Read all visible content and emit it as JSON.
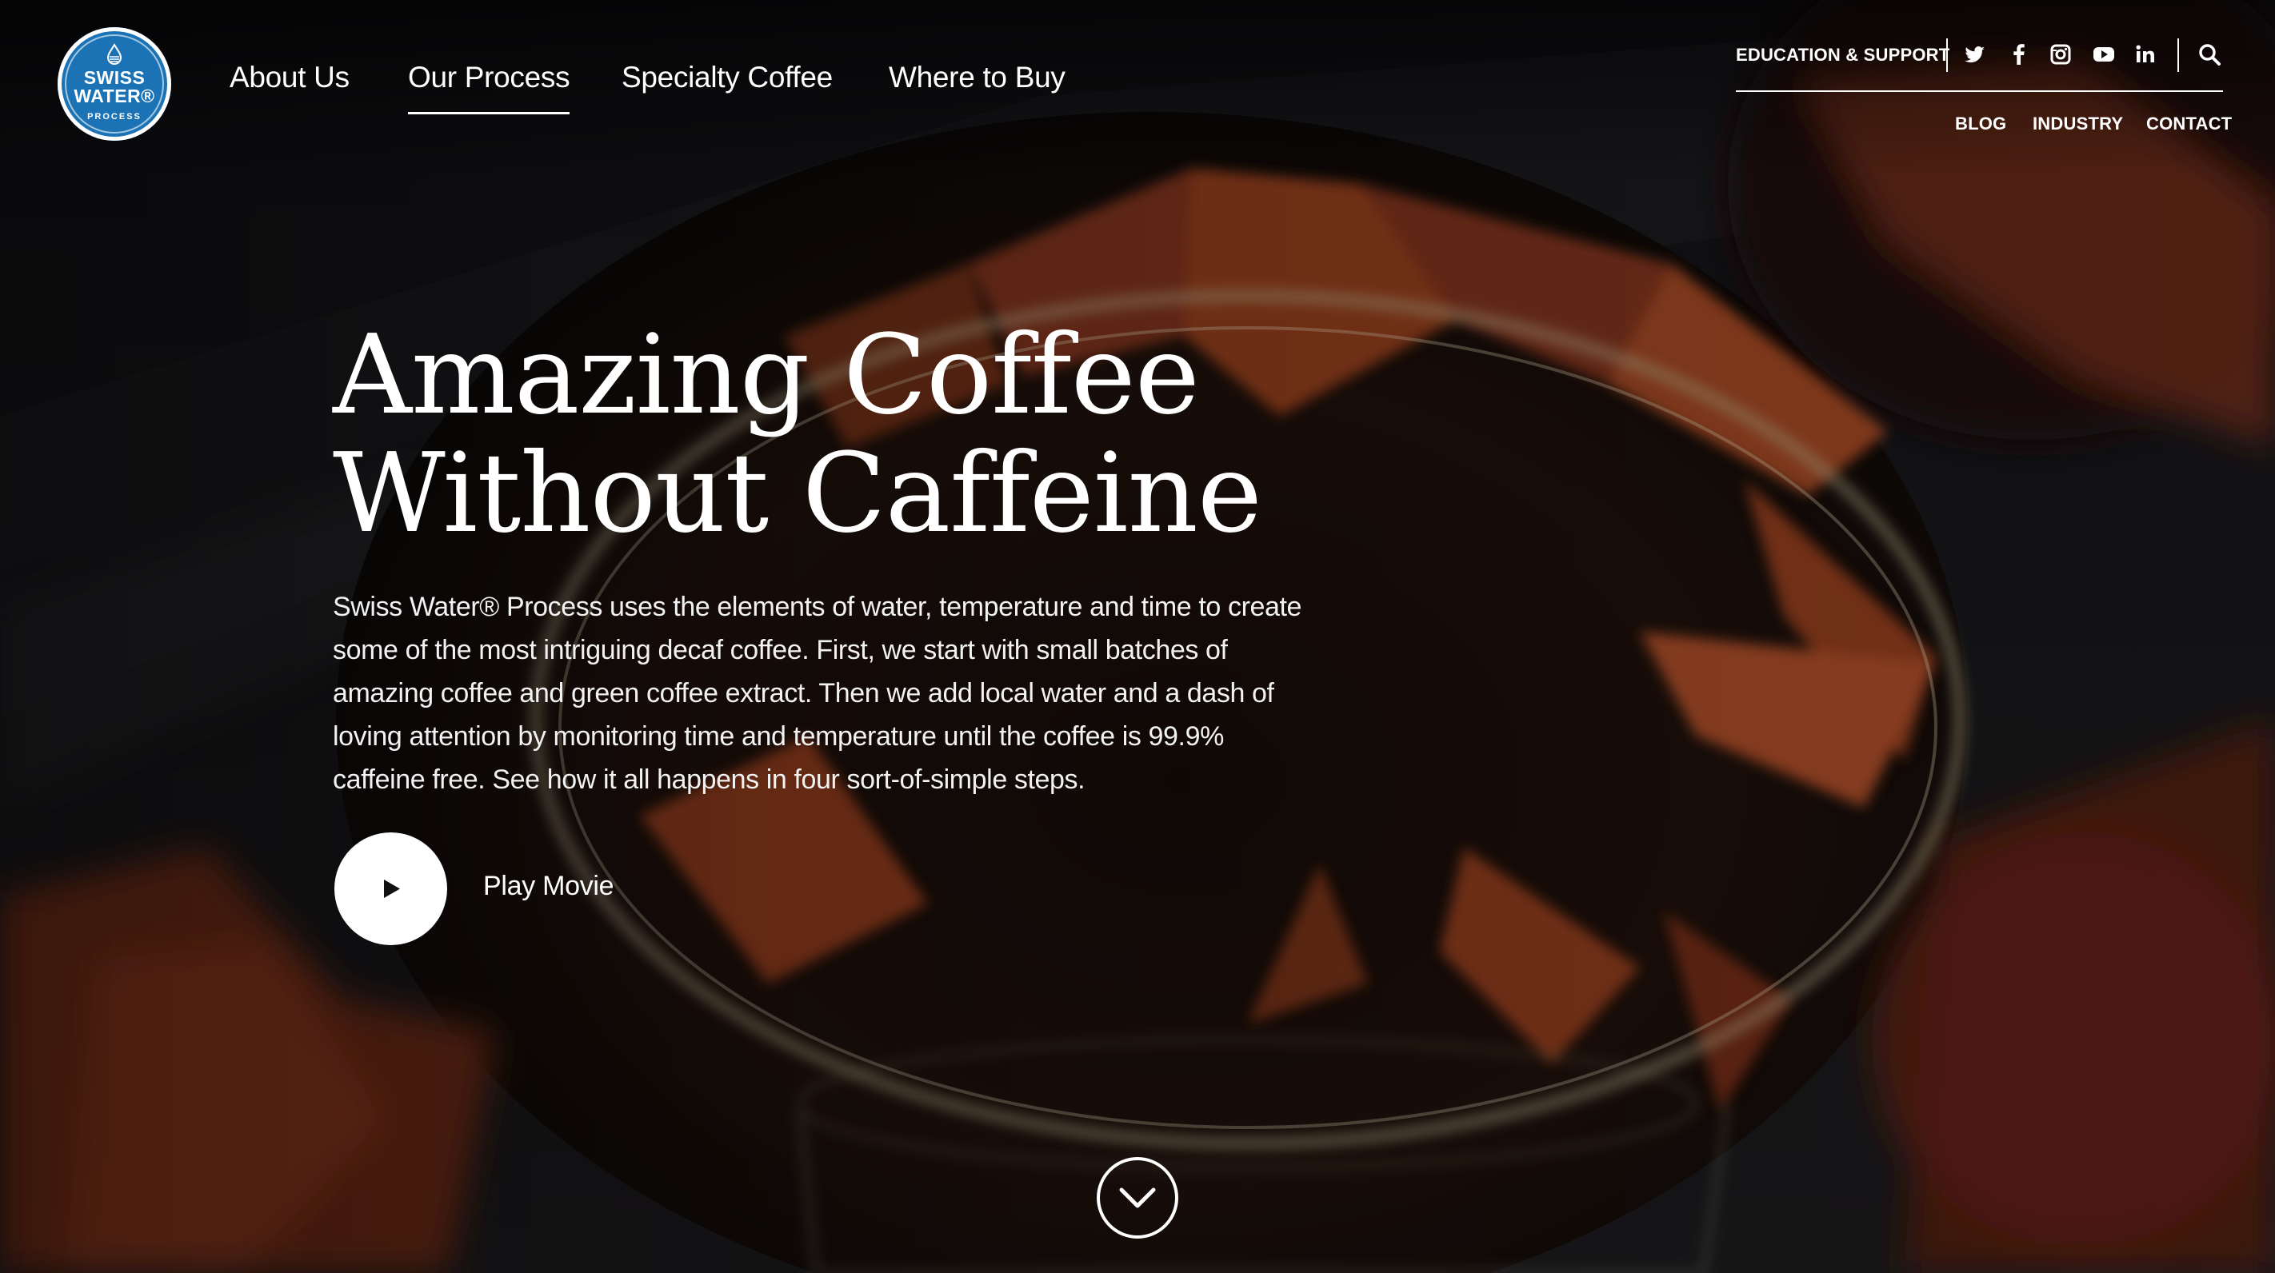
{
  "logo": {
    "line1": "SWISS",
    "line2": "WATER®",
    "line3": "PROCESS"
  },
  "main_nav": [
    {
      "label": "About Us",
      "active": false
    },
    {
      "label": "Our Process",
      "active": true
    },
    {
      "label": "Specialty Coffee",
      "active": false
    },
    {
      "label": "Where to Buy",
      "active": false
    }
  ],
  "utility_nav": {
    "education": "EDUCATION & SUPPORT",
    "social_icons": [
      "twitter-icon",
      "facebook-icon",
      "instagram-icon",
      "youtube-icon",
      "linkedin-icon"
    ],
    "search_icon": "search-icon",
    "secondary": [
      "BLOG",
      "INDUSTRY",
      "CONTACT"
    ]
  },
  "hero": {
    "headline_line1": "Amazing Coffee",
    "headline_line2": "Without Caffeine",
    "body": "Swiss Water® Process uses the elements of water, temperature and time to create some of the most intriguing decaf coffee. First, we start with small batches of amazing coffee and green coffee extract. Then we add local water and a dash of loving attention by monitoring time and temperature until the coffee is 99.9% caffeine free. See how it all happens in four sort-of-simple steps.",
    "play_label": "Play Movie",
    "scroll_icon": "chevron-down-icon"
  },
  "colors": {
    "brand_blue": "#1b73b5",
    "text": "#ffffff",
    "background": "#0e0b0a",
    "filter_paper": "#8a3a1c"
  }
}
